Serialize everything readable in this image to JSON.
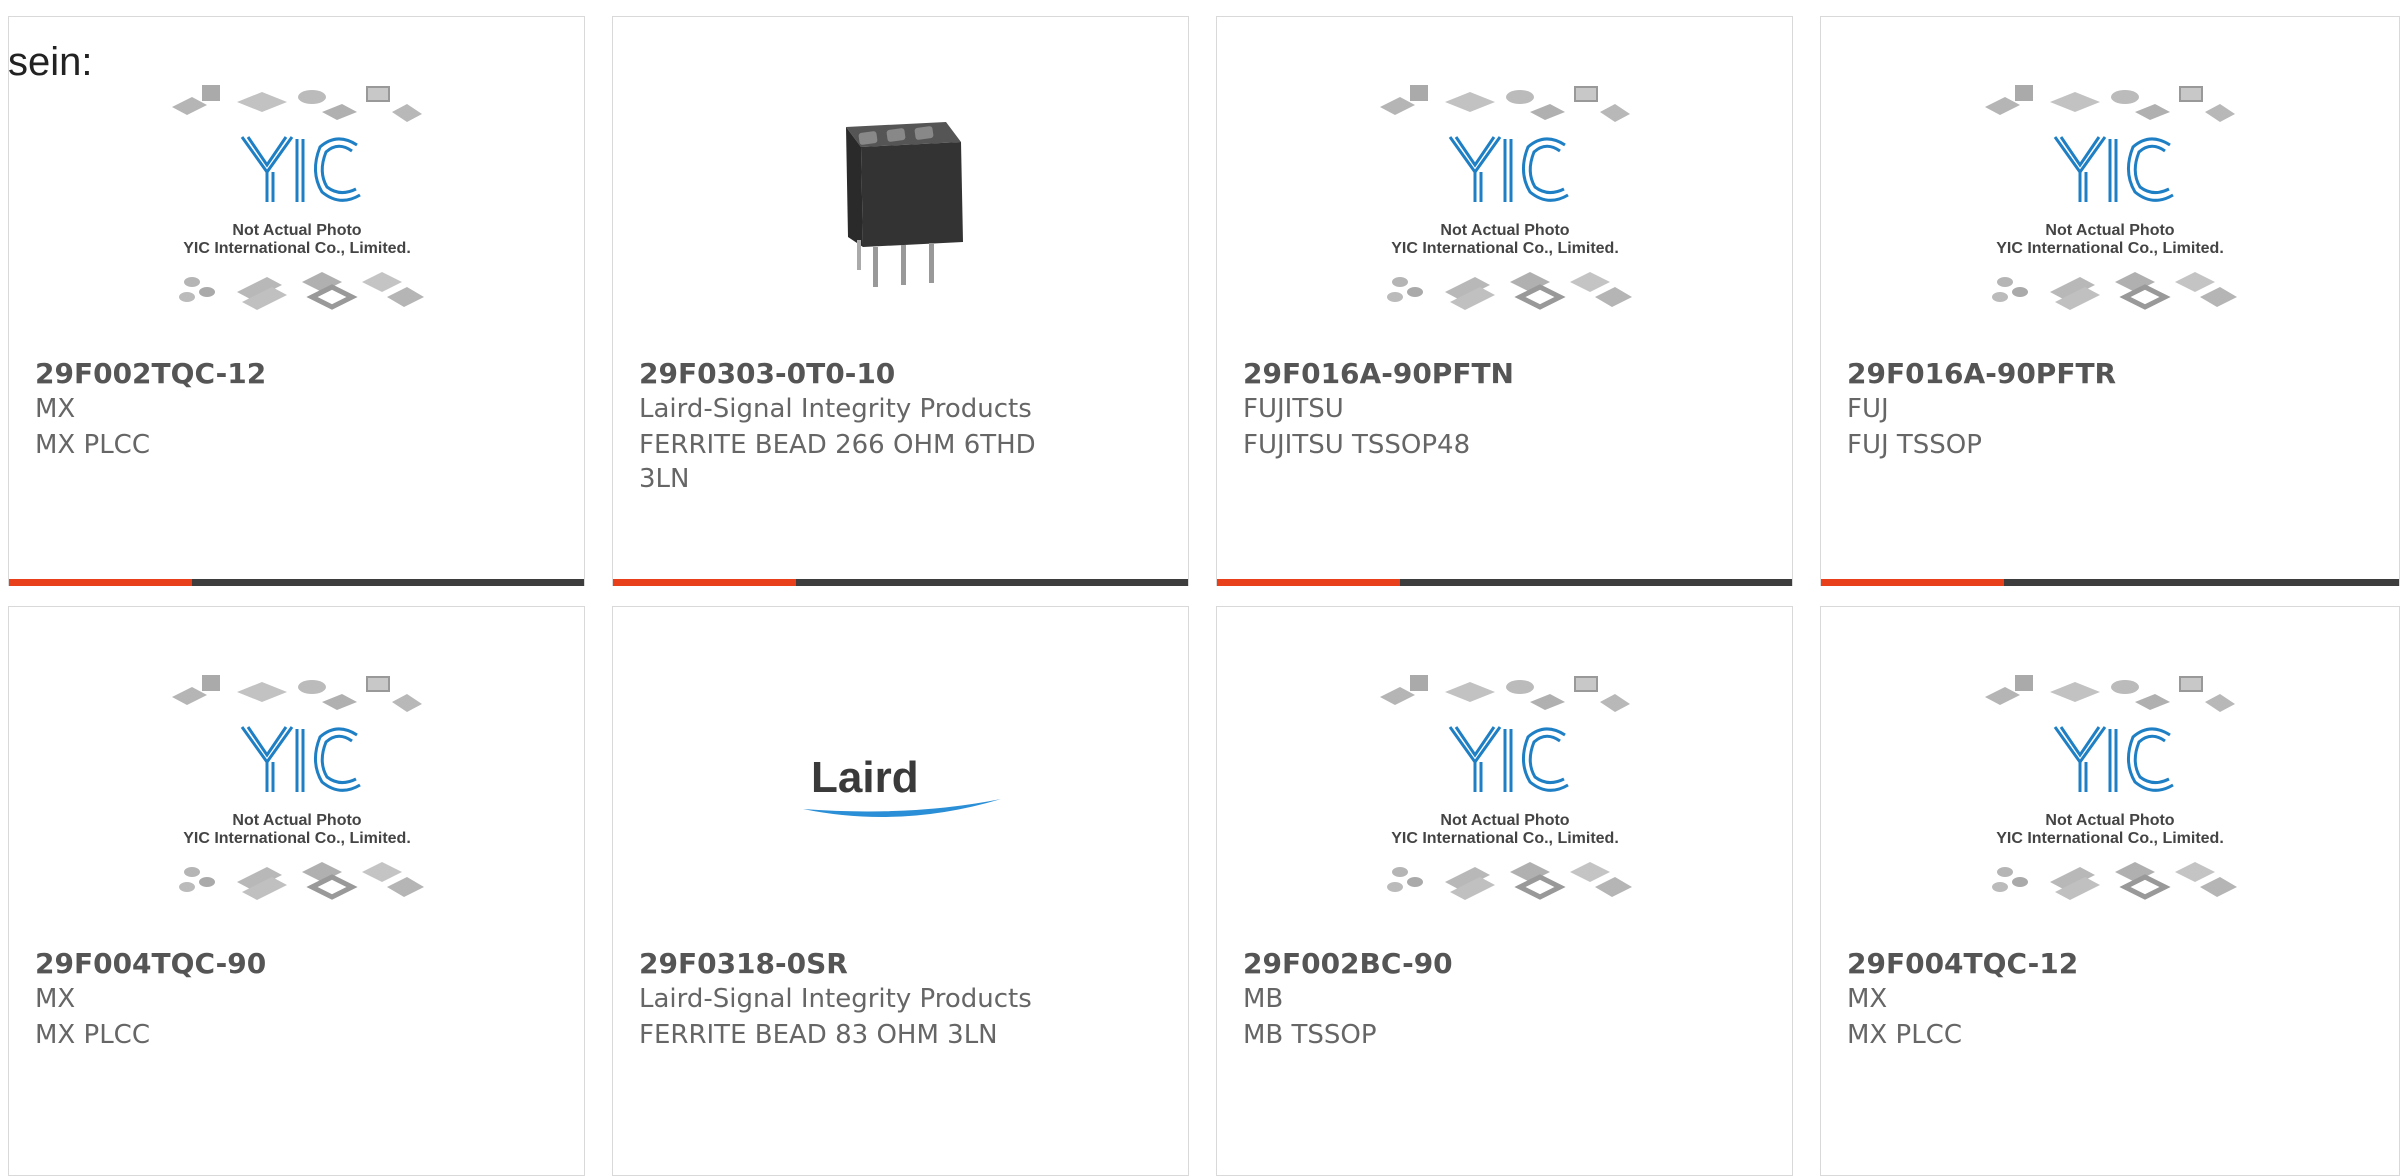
{
  "page": {
    "heading": "sein:"
  },
  "colors": {
    "accent": "#e8401a",
    "bar": "#3d3d3d",
    "yic_blue": "#1f7fc4"
  },
  "placeholder": {
    "line1": "Not Actual Photo",
    "line2": "YIC International Co., Limited.",
    "logo_text": "YIC"
  },
  "laird_logo_text": "Laird",
  "cards": [
    {
      "part": "29F002TQC-12",
      "maker": "MX",
      "desc": "MX PLCC",
      "image": "placeholder"
    },
    {
      "part": "29F0303-0T0-10",
      "maker": "Laird-Signal Integrity Products",
      "desc": "FERRITE BEAD 266 OHM 6THD 3LN",
      "image": "product-photo"
    },
    {
      "part": "29F016A-90PFTN",
      "maker": "FUJITSU",
      "desc": "FUJITSU TSSOP48",
      "image": "placeholder"
    },
    {
      "part": "29F016A-90PFTR",
      "maker": "FUJ",
      "desc": "FUJ TSSOP",
      "image": "placeholder"
    },
    {
      "part": "29F004TQC-90",
      "maker": "MX",
      "desc": "MX PLCC",
      "image": "placeholder"
    },
    {
      "part": "29F0318-0SR",
      "maker": "Laird-Signal Integrity Products",
      "desc": "FERRITE BEAD 83 OHM 3LN",
      "image": "laird-logo"
    },
    {
      "part": "29F002BC-90",
      "maker": "MB",
      "desc": "MB TSSOP",
      "image": "placeholder"
    },
    {
      "part": "29F004TQC-12",
      "maker": "MX",
      "desc": "MX PLCC",
      "image": "placeholder"
    }
  ]
}
